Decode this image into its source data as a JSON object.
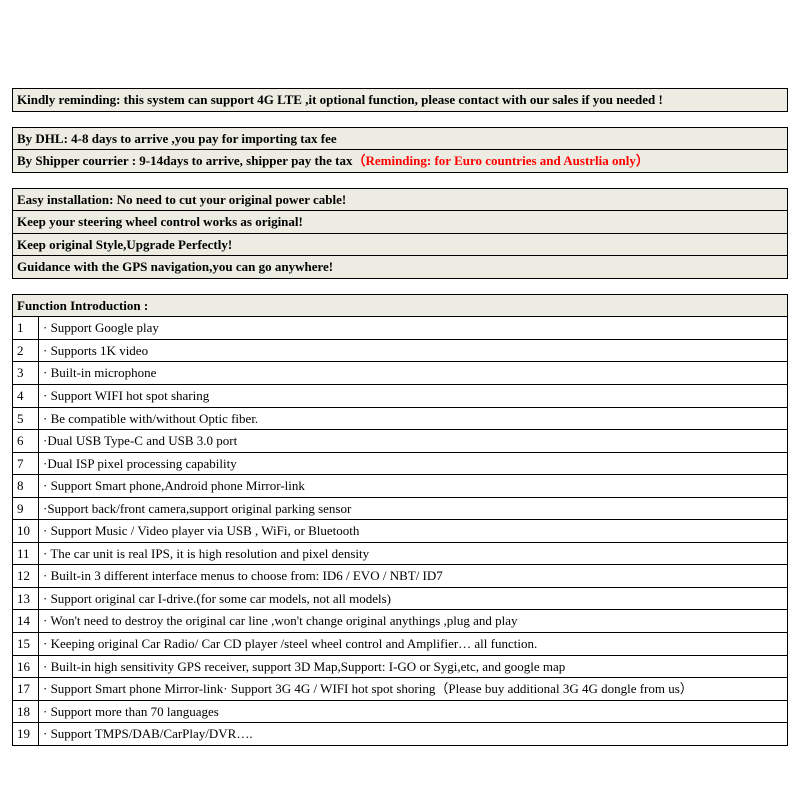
{
  "notice": "Kindly reminding: this system can support 4G LTE ,it optional function, please contact with our sales if you needed !",
  "shipping": {
    "dhl": "By DHL: 4-8 days to arrive ,you pay for  importing tax fee",
    "courier_prefix": "By Shipper courrier : 9-14days to arrive, shipper pay the tax",
    "courier_red": "（Reminding: for Euro countries and Austrlia only）"
  },
  "highlights": [
    "Easy installation: No need to cut your original power cable!",
    "Keep your steering wheel control works as original!",
    "Keep original Style,Upgrade Perfectly!",
    "Guidance with the GPS navigation,you can go anywhere!"
  ],
  "section_title": "Function Introduction :",
  "items": [
    "· Support Google play",
    "· Supports 1K video",
    "· Built-in microphone",
    "· Support WIFI hot spot sharing",
    "· Be compatible with/without Optic fiber.",
    "·Dual USB Type-C and USB 3.0 port",
    "·Dual ISP pixel processing capability",
    "· Support Smart phone,Android phone Mirror-link",
    "·Support back/front camera,support original parking sensor",
    "· Support Music / Video player via USB , WiFi, or Bluetooth",
    "· The car unit is real IPS, it is high resolution and pixel density",
    "· Built-in 3 different interface menus to choose from: ID6 / EVO / NBT/ ID7",
    "· Support original car I-drive.(for some car models, not all models)",
    "· Won't need to destroy the original car line ,won't change original anythings ,plug and play",
    "· Keeping original Car Radio/ Car CD player /steel wheel control and Amplifier… all function.",
    "· Built-in high sensitivity GPS receiver, support 3D Map,Support: I-GO or Sygi,etc, and google map",
    "· Support Smart phone Mirror-link· Support 3G 4G / WIFI hot spot shoring（Please buy additional 3G 4G dongle from us）",
    "· Support more than 70 languages",
    "· Support TMPS/DAB/CarPlay/DVR…."
  ],
  "nums": [
    "1",
    "2",
    "3",
    "4",
    "5",
    "6",
    "7",
    "8",
    "9",
    "10",
    "11",
    "12",
    "13",
    "14",
    "15",
    "16",
    "17",
    "18",
    "19"
  ]
}
